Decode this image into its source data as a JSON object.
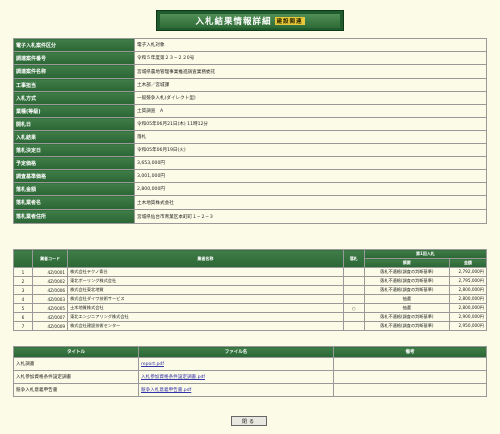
{
  "title": {
    "text": "入札結果情報詳細",
    "tag": "建設関連"
  },
  "info": [
    {
      "label": "電子入札案件区分",
      "value": "電子入札対象"
    },
    {
      "label": "調達案件番号",
      "value": "令和５年度第２３−２２0号"
    },
    {
      "label": "調達案件名称",
      "value": "宮城県農地管理事業推進調査業務委託"
    },
    {
      "label": "工事担当",
      "value": "土木部／宮城課"
    },
    {
      "label": "入札方式",
      "value": "一般競争入札(ダイレクト型)"
    },
    {
      "label": "業種(等級)",
      "value": "土質調査　A"
    },
    {
      "label": "開札日",
      "value": "令和05年06月21日(木) 11時12分"
    },
    {
      "label": "入札結果",
      "value": "落札"
    },
    {
      "label": "落札決定日",
      "value": "令和05年06月19日(火)"
    },
    {
      "label": "予定価格",
      "value": "3,653,000円"
    },
    {
      "label": "調査基準価格",
      "value": "3,001,000円"
    },
    {
      "label": "落札金額",
      "value": "2,800,000円"
    },
    {
      "label": "落札業者名",
      "value": "土木地質株式会社"
    },
    {
      "label": "落札業者住所",
      "value": "宮城県仙台市青葉区本町町１−２−３"
    }
  ],
  "bids": {
    "headers": {
      "blank": "",
      "code": "業者コード",
      "name": "業者名称",
      "award": "落札",
      "first": "第1回入札",
      "remarks": "摘要",
      "amount": "金額"
    },
    "rows": [
      {
        "no": "1",
        "code": "4Z/0001",
        "name": "株式会社テクノ青谷",
        "award": "",
        "remarks": "落札不適格(調査の判断基準)",
        "amount": "2,792,000円"
      },
      {
        "no": "2",
        "code": "4Z/0002",
        "name": "東北ボーリング株式会社",
        "award": "",
        "remarks": "落札不適格(調査の判断基準)",
        "amount": "2,795,000円"
      },
      {
        "no": "3",
        "code": "4Z/0006",
        "name": "株式会社東北地質",
        "award": "",
        "remarks": "落札不適格(調査の判断基準)",
        "amount": "2,800,000円"
      },
      {
        "no": "4",
        "code": "4Z/0003",
        "name": "株式会社ダイワ技術サービス",
        "award": "",
        "remarks": "抽選",
        "amount": "2,800,000円"
      },
      {
        "no": "5",
        "code": "4Z/0005",
        "name": "土木地質株式会社",
        "award": "○",
        "remarks": "抽選",
        "amount": "2,800,000円"
      },
      {
        "no": "6",
        "code": "4Z/0007",
        "name": "東北エンジニアリング株式会社",
        "award": "",
        "remarks": "落札不適格(調査の判断基準)",
        "amount": "2,900,000円"
      },
      {
        "no": "7",
        "code": "4Z/0009",
        "name": "株式会社建設技術センター",
        "award": "",
        "remarks": "落札不適格(調査の判断基準)",
        "amount": "2,950,000円"
      }
    ]
  },
  "files": {
    "headers": {
      "title": "タイトル",
      "filename": "ファイル名",
      "remarks": "備考"
    },
    "rows": [
      {
        "title": "入札調書",
        "filename": "report.pdf",
        "remarks": ""
      },
      {
        "title": "入札参加資格条件設定調書",
        "filename": "入札参加資格条件設定調書.pdf",
        "remarks": ""
      },
      {
        "title": "競争入札意義申告書",
        "filename": "競争入札意義申告書.pdf",
        "remarks": ""
      }
    ]
  },
  "close_button": "閉る"
}
